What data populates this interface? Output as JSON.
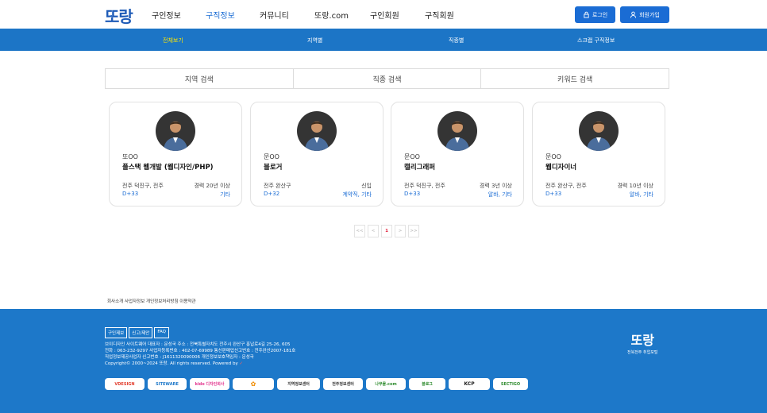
{
  "header": {
    "logo_text": "또랑",
    "nav": [
      "구인정보",
      "구직정보",
      "커뮤니티",
      "또랑.com",
      "구인회원",
      "구직회원"
    ],
    "active_nav": "구직정보",
    "login_label": "로그인",
    "signup_label": "회원가입"
  },
  "subnav": [
    "전체보기",
    "지역별",
    "직종별",
    "스크랩 구직정보"
  ],
  "search_tabs": [
    "지역 검색",
    "직종 검색",
    "키워드 검색"
  ],
  "cards": [
    {
      "name": "또OO",
      "title": "풀스택 웹개발 (웹디자인/PHP)",
      "location": "전주 덕진구, 전주",
      "experience": "경력 20년 이상",
      "dday": "D+33",
      "type": "기타"
    },
    {
      "name": "문OO",
      "title": "블로거",
      "location": "전주 완산구",
      "experience": "신입",
      "dday": "D+32",
      "type": "계약직, 기타"
    },
    {
      "name": "문OO",
      "title": "캘리그래퍼",
      "location": "전주 덕진구, 전주",
      "experience": "경력 3년 이상",
      "dday": "D+33",
      "type": "알바, 기타"
    },
    {
      "name": "문OO",
      "title": "웹디자이너",
      "location": "전주 완산구, 전주",
      "experience": "경력 10년 이상",
      "dday": "D+33",
      "type": "알바, 기타"
    }
  ],
  "pagination": {
    "first": "<<",
    "prev": "<",
    "current": "1",
    "next": ">",
    "last": ">>"
  },
  "footer": {
    "links": "회사소개 사업자정보 개인정보처리방침 이용약관",
    "buttons": [
      "구인제보",
      "신고/제안",
      "FAQ"
    ],
    "info_lines": [
      "브이디자인 사이트웨어 대표자 : 문성국 주소 : 전북특별자치도 전주시 완산구 홍납로4길 25-26, 605",
      "전화 : 063-232-9297 사업자등록번호 : 402-07-69989 통신판매업신고번호 : 전주완산2007-181호",
      "직업정보제공사업자 신고번호 : J1611320090006 개인정보보호책임자 : 문성국",
      "Copyright© 2000~2024 또랑. All rights reserved. Powered by"
    ],
    "badges": [
      "VDESIGN",
      "SITEWARE",
      "kido 디자인회사",
      "",
      "지역정보센터",
      "전주정보센터",
      "나무몰.com",
      "블로그",
      "KCP",
      "SECTIGO"
    ],
    "logo_text": "또랑",
    "logo_sub": "전북전주 취업포털"
  }
}
